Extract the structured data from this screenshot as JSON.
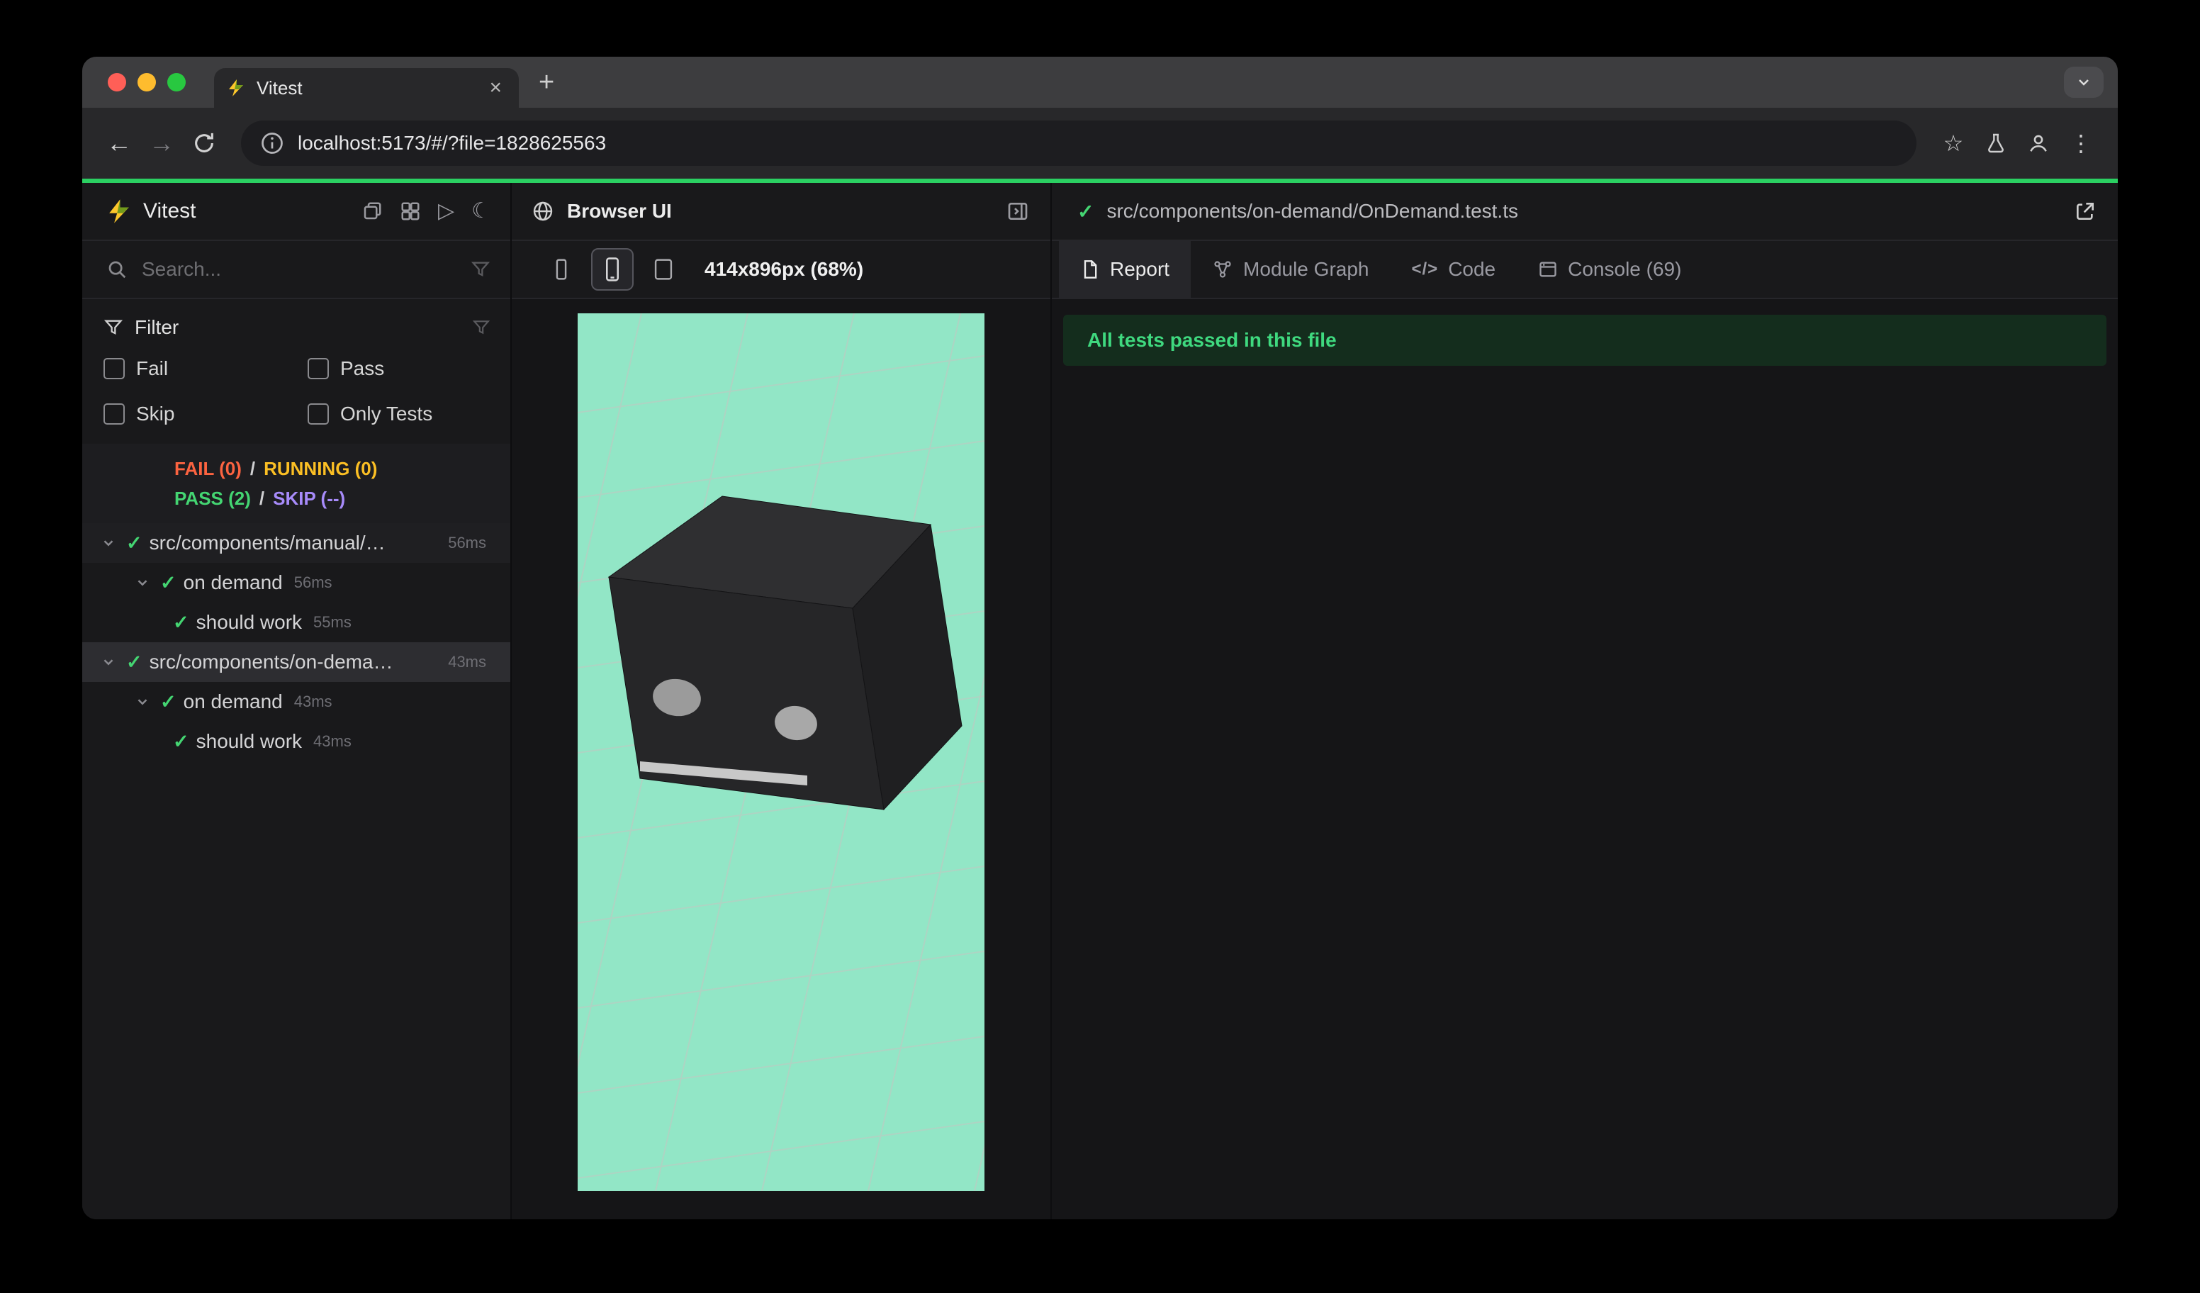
{
  "browser": {
    "tab_title": "Vitest",
    "url": "localhost:5173/#/?file=1828625563"
  },
  "icons": {
    "close": "×",
    "new_tab": "+",
    "back": "←",
    "forward": "→",
    "star": "☆",
    "menu_dots": "⋮",
    "play": "▷",
    "moon": "☾",
    "check": "✓",
    "code": "</>"
  },
  "sidebar": {
    "title": "Vitest",
    "search_placeholder": "Search...",
    "filter_title": "Filter",
    "filters": [
      "Fail",
      "Pass",
      "Skip",
      "Only Tests"
    ],
    "summary": {
      "fail": "FAIL (0)",
      "running": "RUNNING (0)",
      "pass": "PASS (2)",
      "skip": "SKIP (--)",
      "sep": "/"
    },
    "tree": [
      {
        "label": "src/components/manual/…",
        "time": "56ms"
      },
      {
        "label": "on demand",
        "time": "56ms"
      },
      {
        "label": "should work",
        "time": "55ms"
      },
      {
        "label": "src/components/on-dema…",
        "time": "43ms"
      },
      {
        "label": "on demand",
        "time": "43ms"
      },
      {
        "label": "should work",
        "time": "43ms"
      }
    ]
  },
  "browser_panel": {
    "title": "Browser UI",
    "size_label": "414x896px (68%)"
  },
  "report_panel": {
    "file_path": "src/components/on-demand/OnDemand.test.ts",
    "tabs": [
      "Report",
      "Module Graph",
      "Code",
      "Console (69)"
    ],
    "banner": "All tests passed in this file"
  },
  "colors": {
    "accent_green": "#2bd062",
    "pass_green": "#44d572",
    "fail_red": "#fb6340",
    "running_yellow": "#fbbf24",
    "skip_purple": "#a78bfa",
    "viewport_bg": "#92e6c6",
    "banner_bg": "#142d1d",
    "banner_text": "#3fd97f"
  }
}
